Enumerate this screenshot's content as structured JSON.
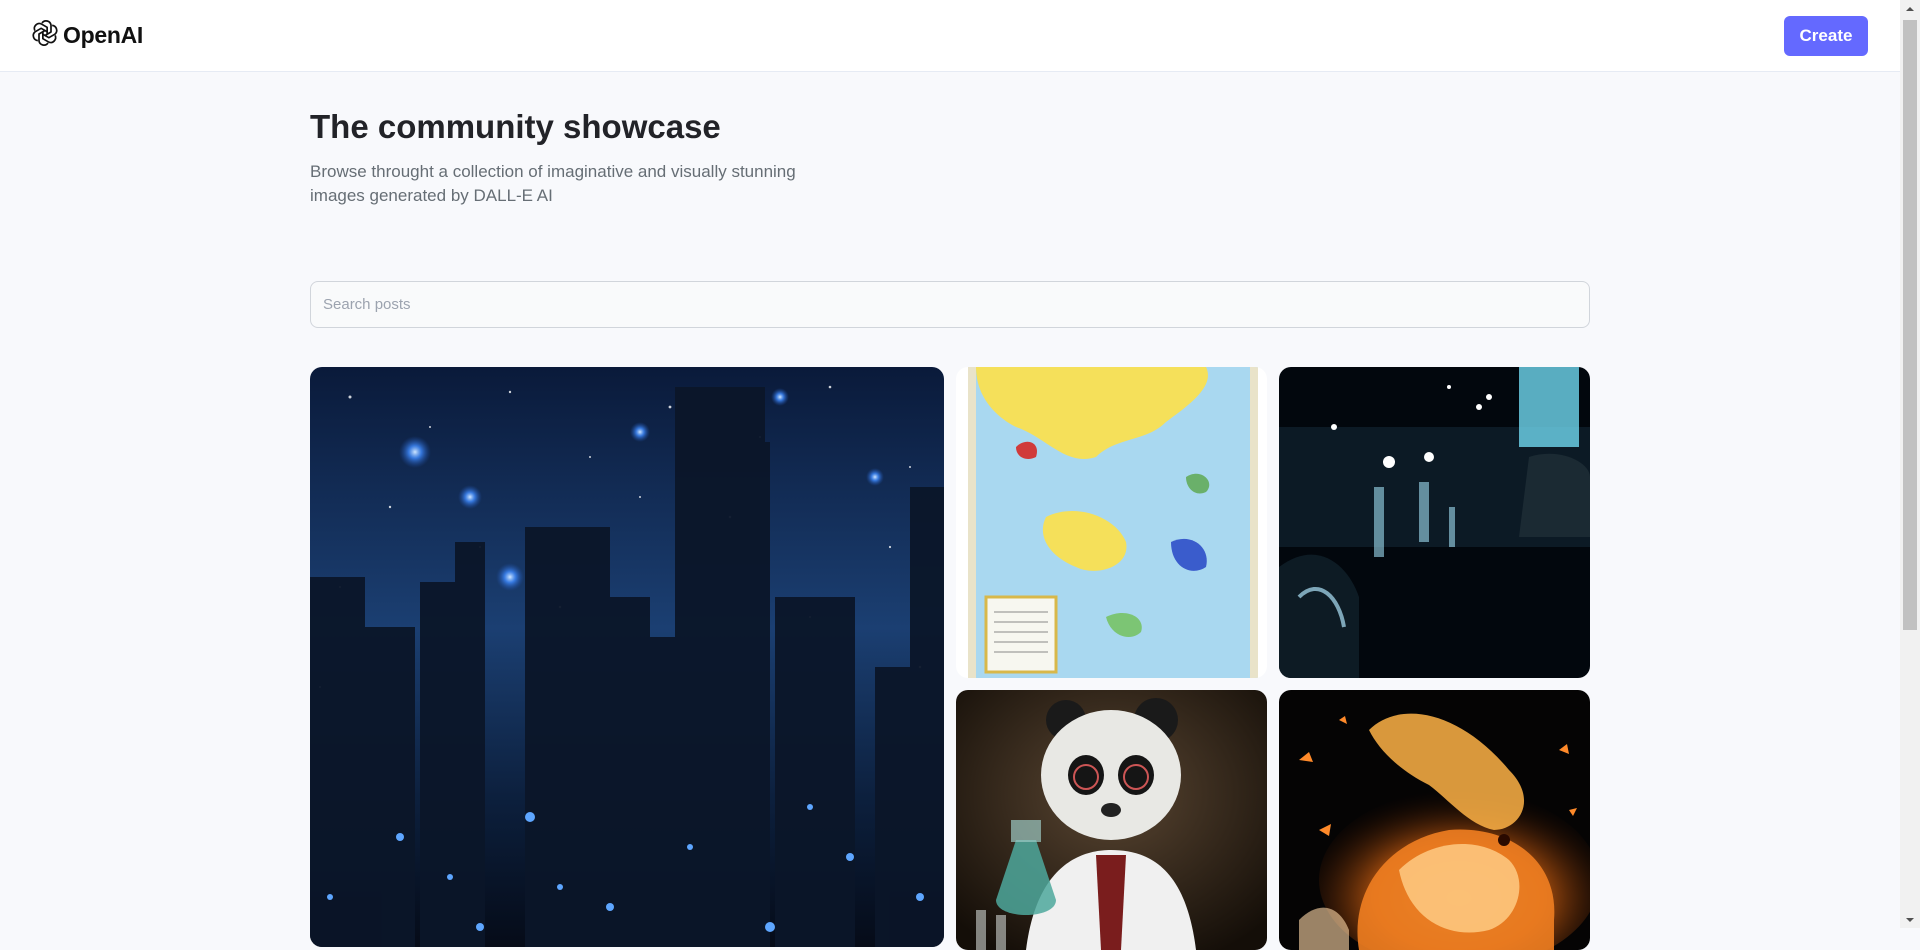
{
  "header": {
    "brand_name": "OpenAI",
    "logo_icon": "openai-logo-icon",
    "create_label": "Create",
    "accent_color": "#6469ff"
  },
  "hero": {
    "title": "The community showcase",
    "subtitle": "Browse throught a collection of imaginative and visually stunning images generated by DALL-E AI"
  },
  "search": {
    "placeholder": "Search posts",
    "value": ""
  },
  "gallery": {
    "items": [
      {
        "subject": "starry-night-city-skyline"
      },
      {
        "subject": "illustrated-fantasy-map"
      },
      {
        "subject": "rainy-night-street"
      },
      {
        "subject": "panda-scientist"
      },
      {
        "subject": "fire-rabbit"
      }
    ]
  }
}
